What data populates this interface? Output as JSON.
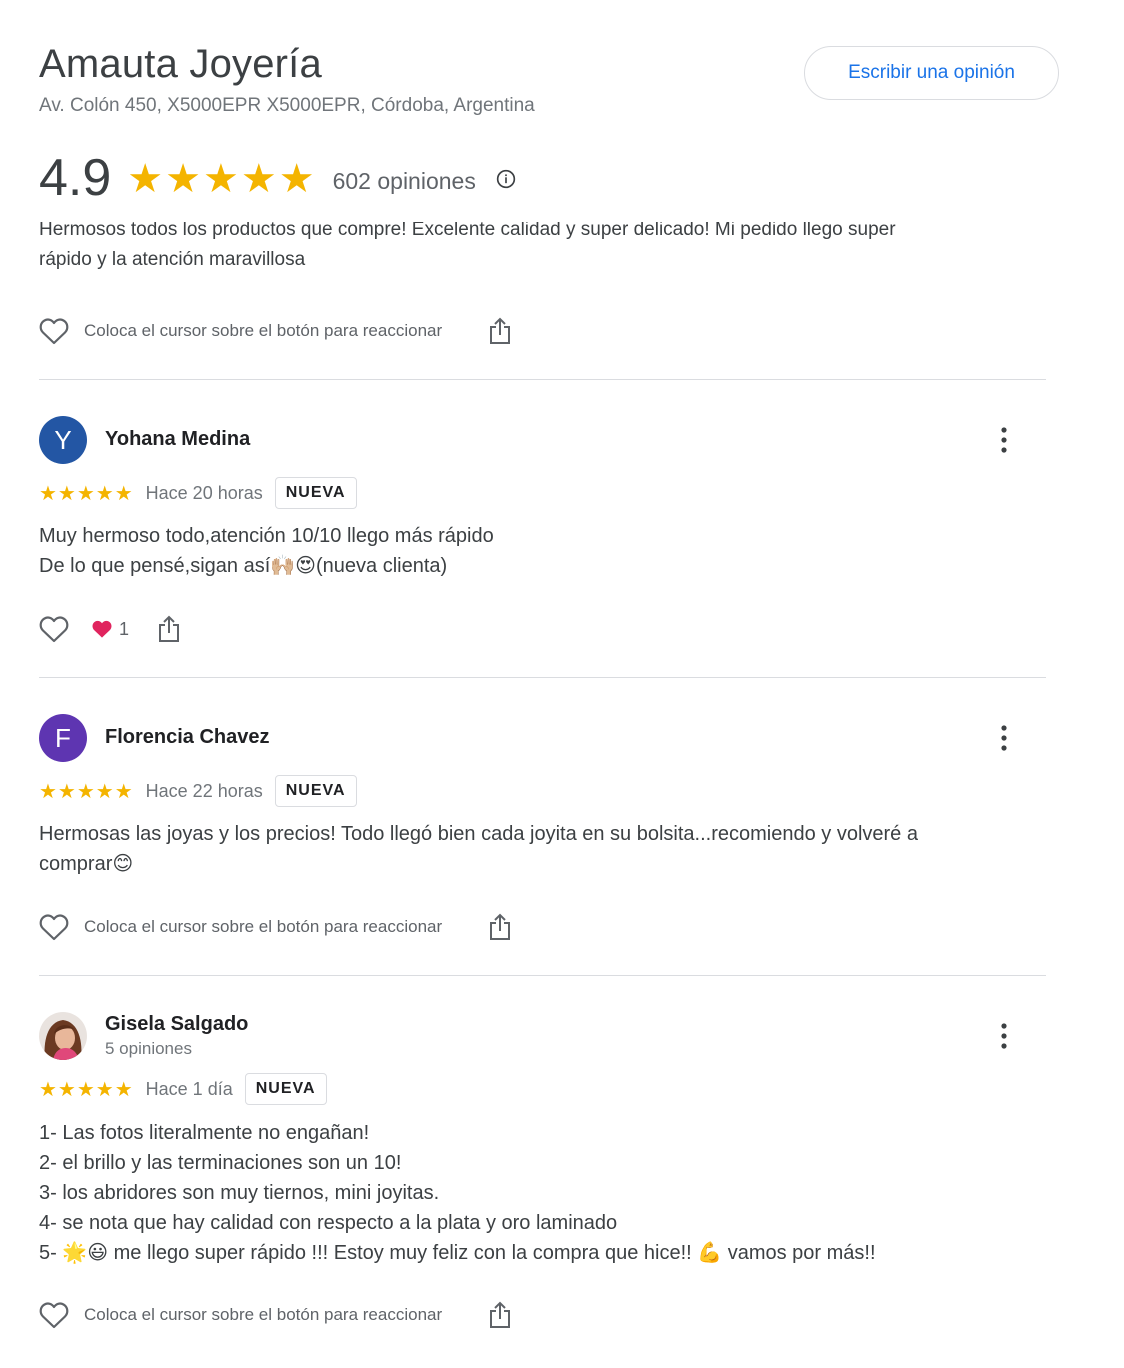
{
  "business": {
    "name": "Amauta Joyería",
    "address": "Av. Colón 450, X5000EPR X5000EPR, Córdoba, Argentina",
    "write_review_label": "Escribir una opinión",
    "rating": "4.9",
    "stars": "★★★★★",
    "review_count": "602 opiniones"
  },
  "partial_review": {
    "text_line1": "Hermosos todos los productos que compre! Excelente calidad y super delicado! Mi pedido llego super",
    "text_line2": "rápido y la atención maravillosa",
    "react_hint": "Coloca el cursor sobre el botón para reaccionar"
  },
  "reviews": [
    {
      "initial": "Y",
      "avatar_color": "#2356a4",
      "author": "Yohana Medina",
      "stars": "★★★★★",
      "time": "Hace 20 horas",
      "badge": "NUEVA",
      "lines": [
        "Muy hermoso todo,atención 10/10 llego más rápido",
        "De lo que pensé,sigan así🙌🏼😍(nueva clienta)"
      ],
      "reaction_emoji": "heart",
      "reaction_count": "1"
    },
    {
      "initial": "F",
      "avatar_color": "#5e35b1",
      "author": "Florencia Chavez",
      "stars": "★★★★★",
      "time": "Hace 22 horas",
      "badge": "NUEVA",
      "lines": [
        "Hermosas las joyas y los precios! Todo llegó bien cada joyita en su bolsita...recomiendo y volveré a",
        "comprar😊"
      ],
      "react_hint": "Coloca el cursor sobre el botón para reaccionar"
    },
    {
      "author": "Gisela Salgado",
      "meta": "5 opiniones",
      "stars": "★★★★★",
      "time": "Hace 1 día",
      "badge": "NUEVA",
      "lines": [
        "1- Las fotos literalmente no engañan!",
        "2- el brillo y las terminaciones son un 10!",
        "3- los abridores son muy tiernos, mini joyitas.",
        "4- se nota que hay calidad con respecto a la plata y oro laminado",
        "5- 🌟😃 me llego super rápido !!! Estoy muy feliz con la compra que hice!! 💪 vamos por más!!"
      ],
      "react_hint": "Coloca el cursor sobre el botón para reaccionar"
    }
  ],
  "colors": {
    "star": "#f4b400",
    "link_blue": "#1a73e8",
    "divider": "#dadce0"
  }
}
